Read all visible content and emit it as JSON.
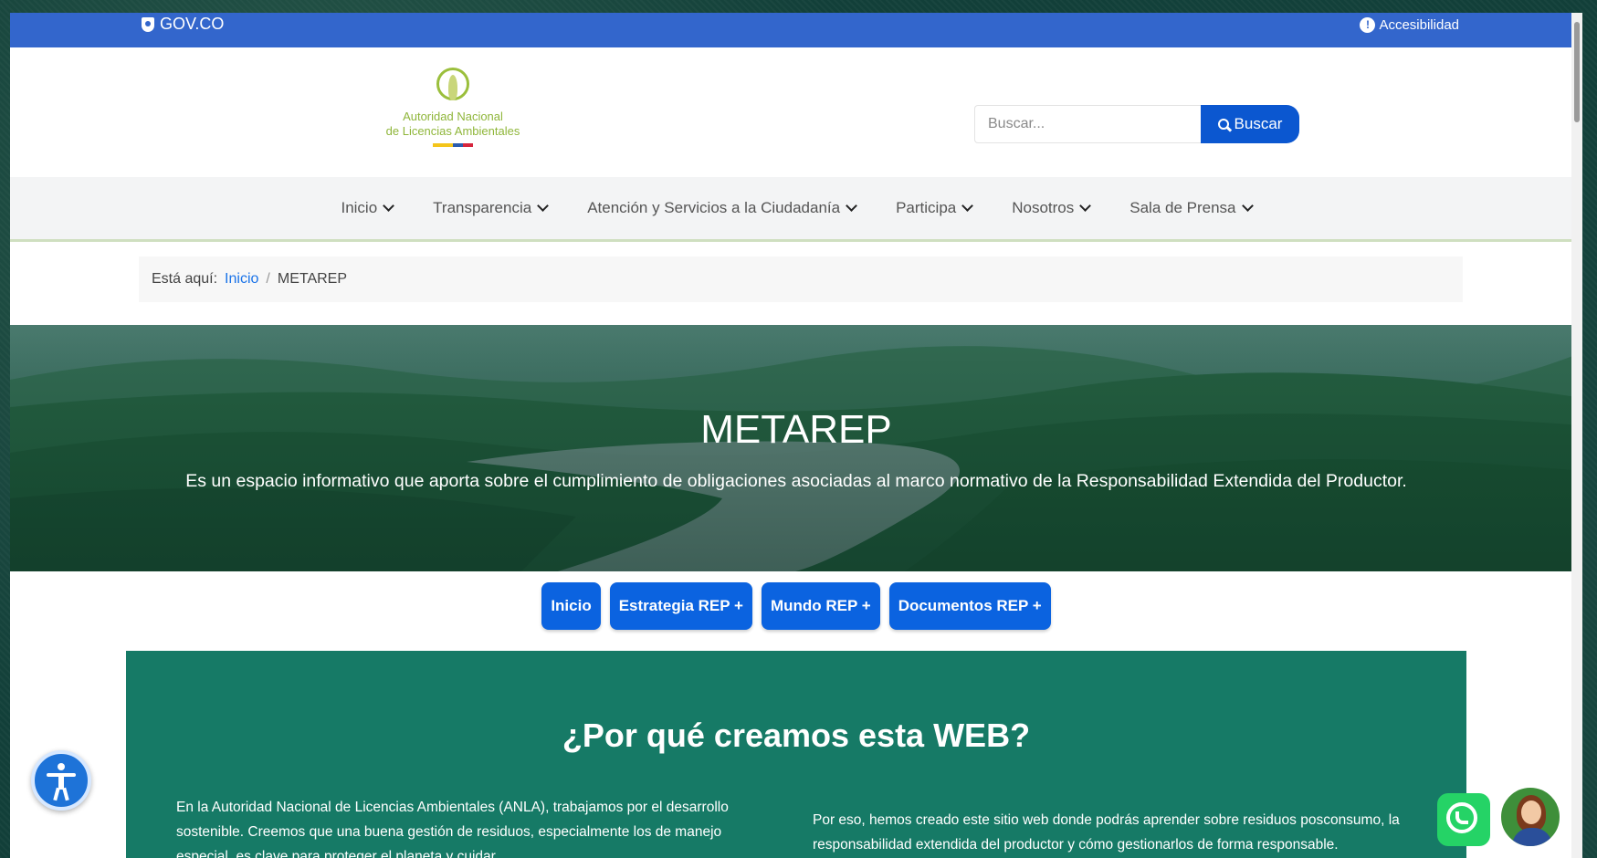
{
  "gov_bar": {
    "brand": "GOV.CO",
    "accessibility_label": "Accesibilidad",
    "color": "#3366cc"
  },
  "header": {
    "logo_line1": "Autoridad Nacional",
    "logo_line2": "de Licencias Ambientales",
    "search": {
      "placeholder": "Buscar...",
      "value": "",
      "button_label": "Buscar"
    }
  },
  "nav": {
    "items": [
      {
        "label": "Inicio"
      },
      {
        "label": "Transparencia"
      },
      {
        "label": "Atención y Servicios a la Ciudadanía"
      },
      {
        "label": "Participa"
      },
      {
        "label": "Nosotros"
      },
      {
        "label": "Sala de Prensa"
      }
    ]
  },
  "breadcrumb": {
    "prefix": "Está aquí:",
    "home": "Inicio",
    "separator": "/",
    "current": "METAREP"
  },
  "hero": {
    "title": "METAREP",
    "subtitle": "Es un espacio informativo que aporta sobre el cumplimiento de obligaciones asociadas al marco normativo de la Responsabilidad Extendida del Productor."
  },
  "pills": [
    {
      "label": "Inicio"
    },
    {
      "label": "Estrategia REP +"
    },
    {
      "label": "Mundo REP +"
    },
    {
      "label": "Documentos REP +"
    }
  ],
  "section": {
    "title": "¿Por qué creamos esta WEB?",
    "p1": "En la Autoridad Nacional de Licencias Ambientales (ANLA), trabajamos por el desarrollo sostenible. Creemos que una buena gestión de residuos, especialmente los de manejo especial, es clave para proteger el planeta y cuidar",
    "p2": "Por eso, hemos creado este sitio web donde podrás aprender sobre residuos posconsumo, la responsabilidad extendida del productor y cómo gestionarlos de forma responsable."
  },
  "colors": {
    "accent": "#0b63e0",
    "section_green": "#167a66",
    "link": "#1a73e8"
  }
}
